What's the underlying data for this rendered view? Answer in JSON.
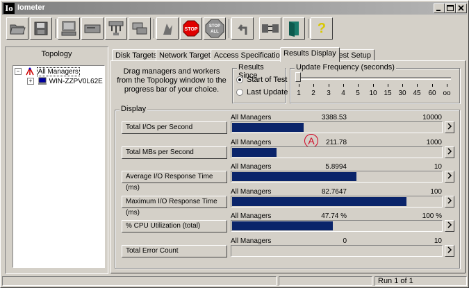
{
  "window": {
    "title": "Iometer",
    "icon_text": "Io",
    "controls": [
      "minimize-icon",
      "maximize-icon",
      "close-icon"
    ]
  },
  "toolbar": {
    "buttons": [
      {
        "name": "open-button",
        "icon": "open-folder-icon"
      },
      {
        "name": "save-button",
        "icon": "floppy-disk-icon"
      },
      {
        "name": "new-manager-button",
        "icon": "computer-icon"
      },
      {
        "name": "new-worker-button",
        "icon": "disk-drive-icon"
      },
      {
        "name": "new-network-worker-button",
        "icon": "network-icon"
      },
      {
        "name": "copy-worker-button",
        "icon": "copy-icon"
      },
      {
        "name": "start-button",
        "icon": "green-flag-icon"
      },
      {
        "name": "stop-button",
        "icon": "stop-sign-icon",
        "label": "STOP"
      },
      {
        "name": "stop-all-button",
        "icon": "stop-all-icon",
        "label": "STOP ALL"
      },
      {
        "name": "reset-workers-button",
        "icon": "reset-arrow-icon"
      },
      {
        "name": "disconnect-button",
        "icon": "disconnect-icon"
      },
      {
        "name": "exit-button",
        "icon": "exit-door-icon"
      },
      {
        "name": "about-button",
        "icon": "question-mark-icon",
        "label": "?"
      }
    ]
  },
  "topology": {
    "title": "Topology",
    "root": "All Managers",
    "children": [
      "WIN-ZZPV0L62E"
    ]
  },
  "tabs": [
    "Disk Targets",
    "Network Targets",
    "Access Specifications",
    "Results Display",
    "Test Setup"
  ],
  "active_tab": "Results Display",
  "instructions": "Drag managers and workers from the Topology window to the progress bar of your choice.",
  "results_since": {
    "title": "Results Since",
    "options": [
      {
        "label": "Start of Test",
        "selected": true
      },
      {
        "label": "Last Update",
        "selected": false
      }
    ]
  },
  "update_frequency": {
    "title": "Update Frequency (seconds)",
    "ticks": [
      "1",
      "2",
      "3",
      "4",
      "5",
      "10",
      "15",
      "30",
      "45",
      "60",
      "oo"
    ],
    "selected": "1"
  },
  "display": {
    "title": "Display",
    "metrics": [
      {
        "name": "Total I/Os per Second",
        "source": "All Managers",
        "value": "3388.53",
        "max": "10000",
        "fill": 0.3389
      },
      {
        "name": "Total MBs per Second",
        "source": "All Managers",
        "value": "211.78",
        "max": "1000",
        "fill": 0.2118
      },
      {
        "name": "Average I/O Response Time (ms)",
        "source": "All Managers",
        "value": "5.8994",
        "max": "10",
        "fill": 0.5899
      },
      {
        "name": "Maximum I/O Response Time (ms)",
        "source": "All Managers",
        "value": "82.7647",
        "max": "100",
        "fill": 0.8276
      },
      {
        "name": "% CPU Utilization (total)",
        "source": "All Managers",
        "value": "47.74 %",
        "max": "100 %",
        "fill": 0.4774
      },
      {
        "name": "Total Error Count",
        "source": "All Managers",
        "value": "0",
        "max": "10",
        "fill": 0
      }
    ]
  },
  "annotation": {
    "label": "A",
    "color": "#d00020"
  },
  "status": {
    "text": "Run 1 of 1"
  },
  "colors": {
    "bar_fill": "#0a246a",
    "face": "#d4d0c8"
  }
}
